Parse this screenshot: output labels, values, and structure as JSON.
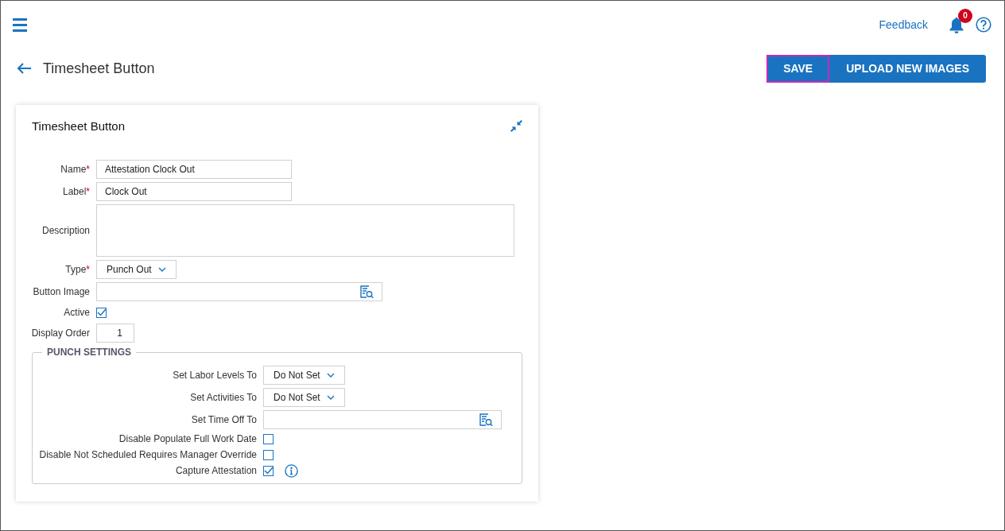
{
  "top_bar": {
    "feedback": "Feedback",
    "notifications": "0"
  },
  "header": {
    "title": "Timesheet Button",
    "buttons": [
      {
        "label": "SAVE",
        "focused": true
      },
      {
        "label": "UPLOAD NEW IMAGES",
        "focused": false
      }
    ]
  },
  "card": {
    "title": "Timesheet Button",
    "fields": [
      {
        "kind": "text",
        "label": "Name",
        "mark": "*",
        "value": "Attestation Clock Out"
      },
      {
        "kind": "text",
        "label": "Label",
        "mark": "*",
        "value": "Clock Out"
      },
      {
        "kind": "textarea",
        "label": "Description"
      },
      {
        "kind": "select",
        "label": "Type",
        "mark": "*",
        "value": "Punch Out"
      },
      {
        "kind": "lookup",
        "label": "Button Image"
      },
      {
        "kind": "checkbox",
        "label": "Active",
        "checked": true
      },
      {
        "kind": "number",
        "label": "Display Order",
        "value": "1"
      }
    ],
    "punch_settings": {
      "legend": "PUNCH SETTINGS",
      "fields": [
        {
          "kind": "select",
          "label": "Set Labor Levels To",
          "value": "Do Not Set"
        },
        {
          "kind": "select",
          "label": "Set Activities To",
          "value": "Do Not Set"
        },
        {
          "kind": "lookup",
          "label": "Set Time Off To"
        },
        {
          "kind": "checkbox",
          "label": "Disable Populate Full Work Date",
          "checked": false
        },
        {
          "kind": "checkbox",
          "label": "Disable Not Scheduled Requires Manager Override",
          "checked": false
        },
        {
          "kind": "checkbox",
          "label": "Capture Attestation",
          "checked": true,
          "info": true
        }
      ]
    }
  }
}
